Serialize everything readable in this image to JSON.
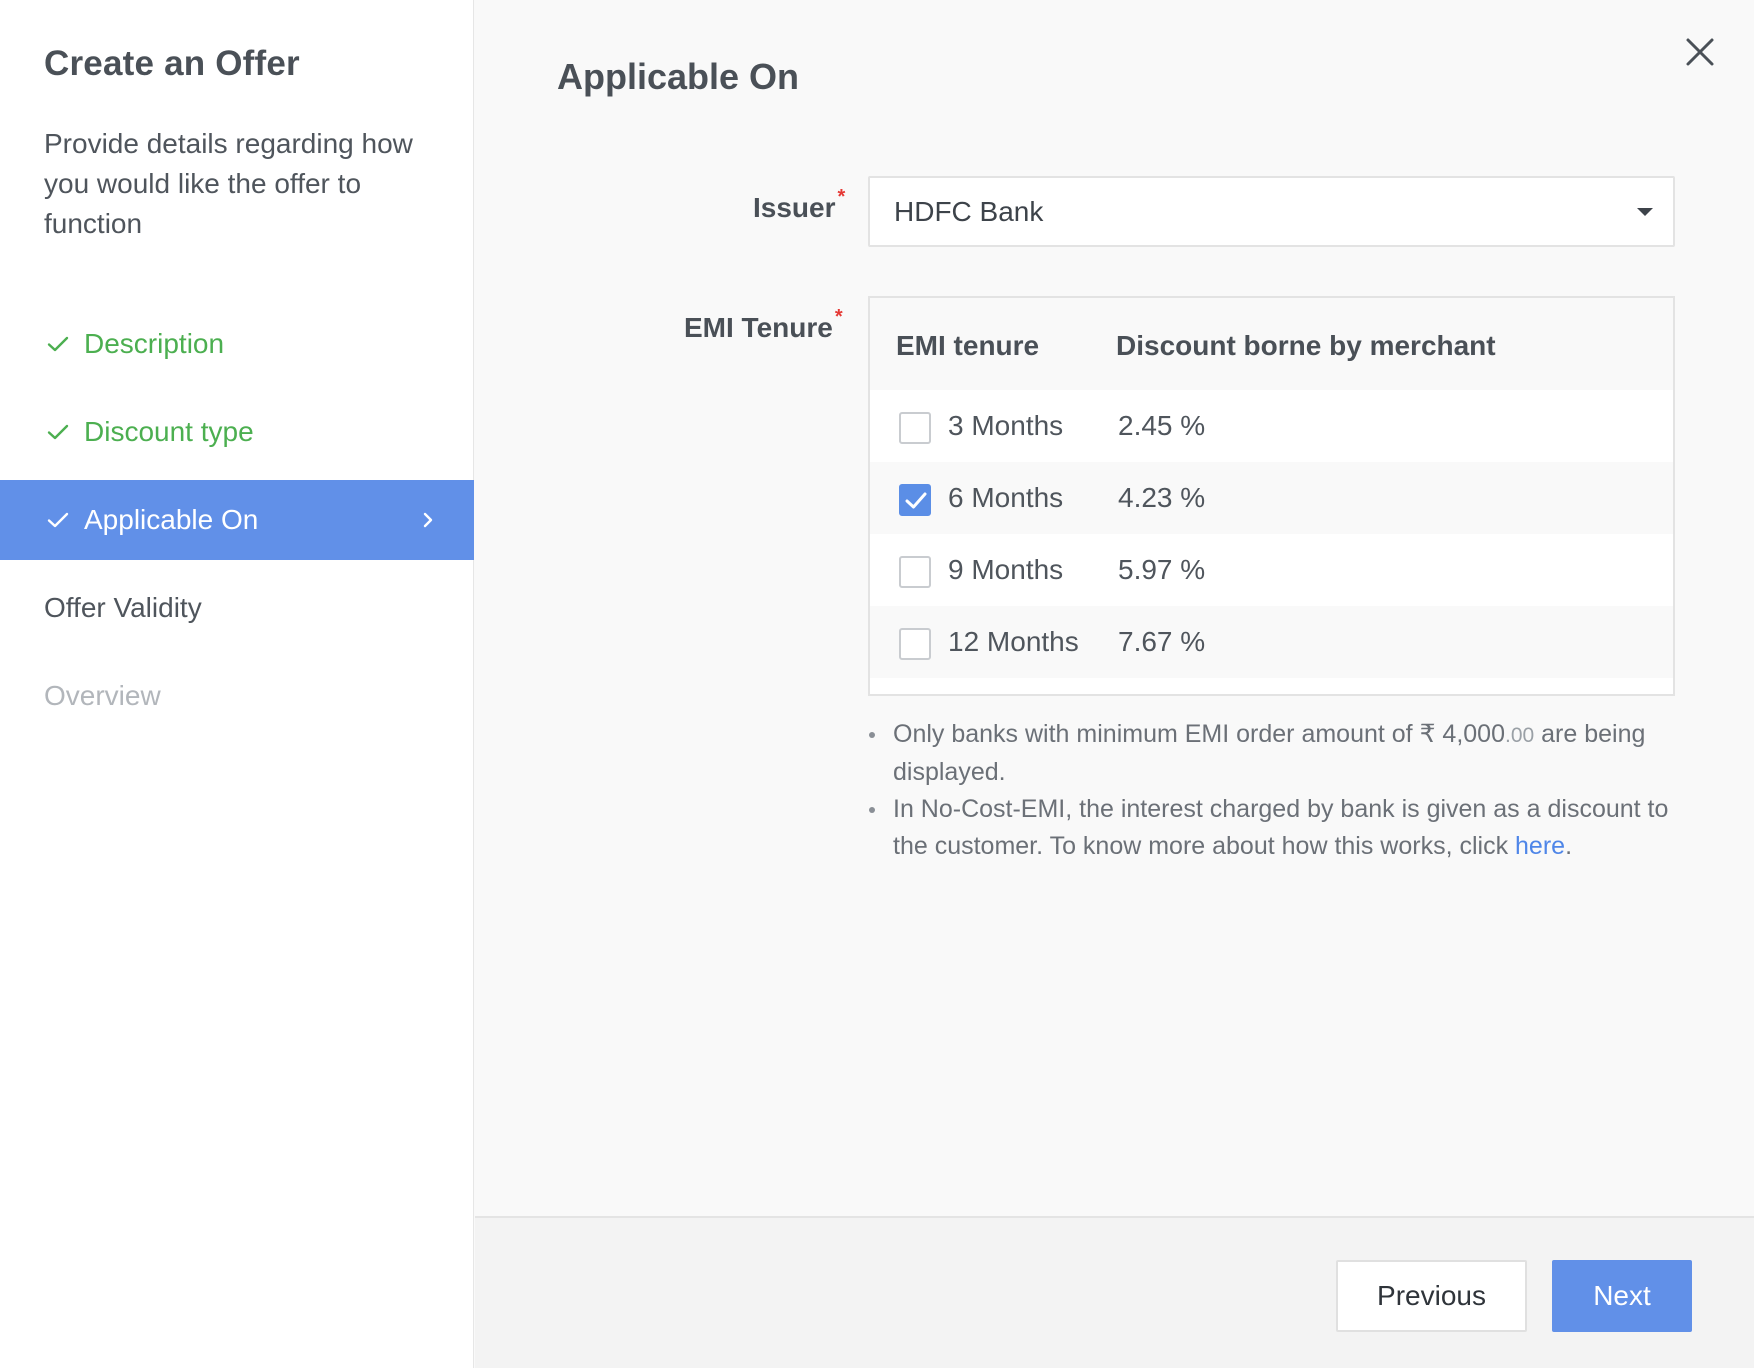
{
  "sidebar": {
    "title": "Create an Offer",
    "description": "Provide details regarding how you would like the offer to function",
    "steps": [
      {
        "label": "Description",
        "state": "done"
      },
      {
        "label": "Discount type",
        "state": "done"
      },
      {
        "label": "Applicable On",
        "state": "active"
      },
      {
        "label": "Offer Validity",
        "state": "pending"
      },
      {
        "label": "Overview",
        "state": "disabled"
      }
    ]
  },
  "main": {
    "title": "Applicable On",
    "issuer": {
      "label": "Issuer",
      "required_mark": "*",
      "selected": "HDFC Bank"
    },
    "emi_tenure": {
      "label": "EMI Tenure",
      "required_mark": "*",
      "columns": [
        "EMI tenure",
        "Discount borne by merchant"
      ],
      "rows": [
        {
          "tenure": "3 Months",
          "discount": "2.45 %",
          "checked": false
        },
        {
          "tenure": "6 Months",
          "discount": "4.23 %",
          "checked": true
        },
        {
          "tenure": "9 Months",
          "discount": "5.97 %",
          "checked": false
        },
        {
          "tenure": "12 Months",
          "discount": "7.67 %",
          "checked": false
        }
      ]
    },
    "notes": {
      "note1_pre": "Only banks with minimum EMI order amount of ",
      "note1_currency": "₹",
      "note1_amount": " 4,000",
      "note1_decimal": ".00",
      "note1_post": " are being displayed.",
      "note2_pre": "In No-Cost-EMI, the interest charged by bank is given as a discount to the customer. To know more about how this works, click ",
      "note2_link": "here",
      "note2_post": "."
    }
  },
  "footer": {
    "previous_label": "Previous",
    "next_label": "Next"
  },
  "colors": {
    "accent": "#6190e8",
    "done": "#4caf50",
    "required": "#e53935",
    "link": "#4f86e8"
  }
}
